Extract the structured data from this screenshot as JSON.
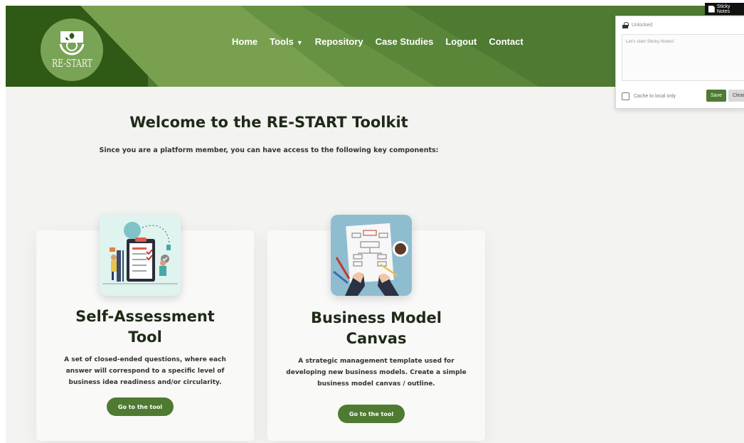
{
  "header": {
    "logo_text": "RE-START",
    "nav": [
      {
        "label": "Home"
      },
      {
        "label": "Tools"
      },
      {
        "label": "Repository"
      },
      {
        "label": "Case Studies"
      },
      {
        "label": "Logout"
      },
      {
        "label": "Contact"
      }
    ],
    "colors": {
      "header_bg": "#4f7a32",
      "dark": "#2f5a15",
      "accent": "#4f7a32"
    }
  },
  "hero": {
    "title": "Welcome to the RE-START Toolkit",
    "subtitle": "Since you are a platform member, you can have access to the following key components:"
  },
  "cards": [
    {
      "title_line1": "Self-Assessment",
      "title_line2": "Tool",
      "desc_lines": [
        "A set of closed-ended questions, where each",
        "answer will correspond to a specific level of",
        "business idea readiness and/or circularity."
      ],
      "button": "Go to the tool",
      "image_icon": "checklist-illustration"
    },
    {
      "title_line1": "Business Model",
      "title_line2": "Canvas",
      "desc_lines": [
        "A strategic management template used for",
        "developing new business models. Create a simple",
        "business model canvas / outline."
      ],
      "button": "Go to the tool",
      "image_icon": "canvas-planning-illustration"
    }
  ],
  "sticky": {
    "tab_label": "Sticky Notes",
    "lock_status": "Unlocked",
    "placeholder": "Let's start Sticky Notes!",
    "cache_label": "Cache to local only",
    "save_label": "Save",
    "clear_label": "Clear"
  }
}
